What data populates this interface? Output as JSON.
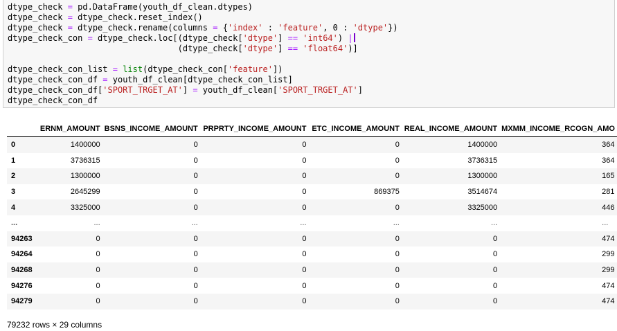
{
  "code_cell": {
    "lines": [
      "dtype_check = pd.DataFrame(youth_df_clean.dtypes)",
      "dtype_check = dtype_check.reset_index()",
      "dtype_check = dtype_check.rename(columns = {'index' : 'feature', 0 : 'dtype'})",
      "dtype_check_con = dtype_check.loc[(dtype_check['dtype'] == 'int64') |",
      "                                  (dtype_check['dtype'] == 'float64')]",
      "",
      "dtype_check_con_list = list(dtype_check_con['feature'])",
      "dtype_check_con_df = youth_df_clean[dtype_check_con_list]",
      "dtype_check_con_df['SPORT_TRGET_AT'] = youth_df_clean['SPORT_TRGET_AT']",
      "dtype_check_con_df"
    ]
  },
  "dataframe": {
    "columns": [
      "",
      "ERNM_AMOUNT",
      "BSNS_INCOME_AMOUNT",
      "PRPRTY_INCOME_AMOUNT",
      "ETC_INCOME_AMOUNT",
      "REAL_INCOME_AMOUNT",
      "MXMM_INCOME_RCOGN_AMO"
    ],
    "rows": [
      [
        "0",
        "1400000",
        "0",
        "0",
        "0",
        "1400000",
        "364"
      ],
      [
        "1",
        "3736315",
        "0",
        "0",
        "0",
        "3736315",
        "364"
      ],
      [
        "2",
        "1300000",
        "0",
        "0",
        "0",
        "1300000",
        "165"
      ],
      [
        "3",
        "2645299",
        "0",
        "0",
        "869375",
        "3514674",
        "281"
      ],
      [
        "4",
        "3325000",
        "0",
        "0",
        "0",
        "3325000",
        "446"
      ],
      [
        "...",
        "...",
        "...",
        "...",
        "...",
        "...",
        "..."
      ],
      [
        "94263",
        "0",
        "0",
        "0",
        "0",
        "0",
        "474"
      ],
      [
        "94264",
        "0",
        "0",
        "0",
        "0",
        "0",
        "299"
      ],
      [
        "94268",
        "0",
        "0",
        "0",
        "0",
        "0",
        "299"
      ],
      [
        "94276",
        "0",
        "0",
        "0",
        "0",
        "0",
        "474"
      ],
      [
        "94279",
        "0",
        "0",
        "0",
        "0",
        "0",
        "474"
      ]
    ]
  },
  "footer": {
    "shape_text": "79232 rows × 29 columns"
  },
  "colors": {
    "code_background": "#f7f7f7",
    "string_color": "#ba2121",
    "builtin_color": "#008000",
    "operator_color": "#aa22ff",
    "row_stripe": "#f5f5f5"
  }
}
